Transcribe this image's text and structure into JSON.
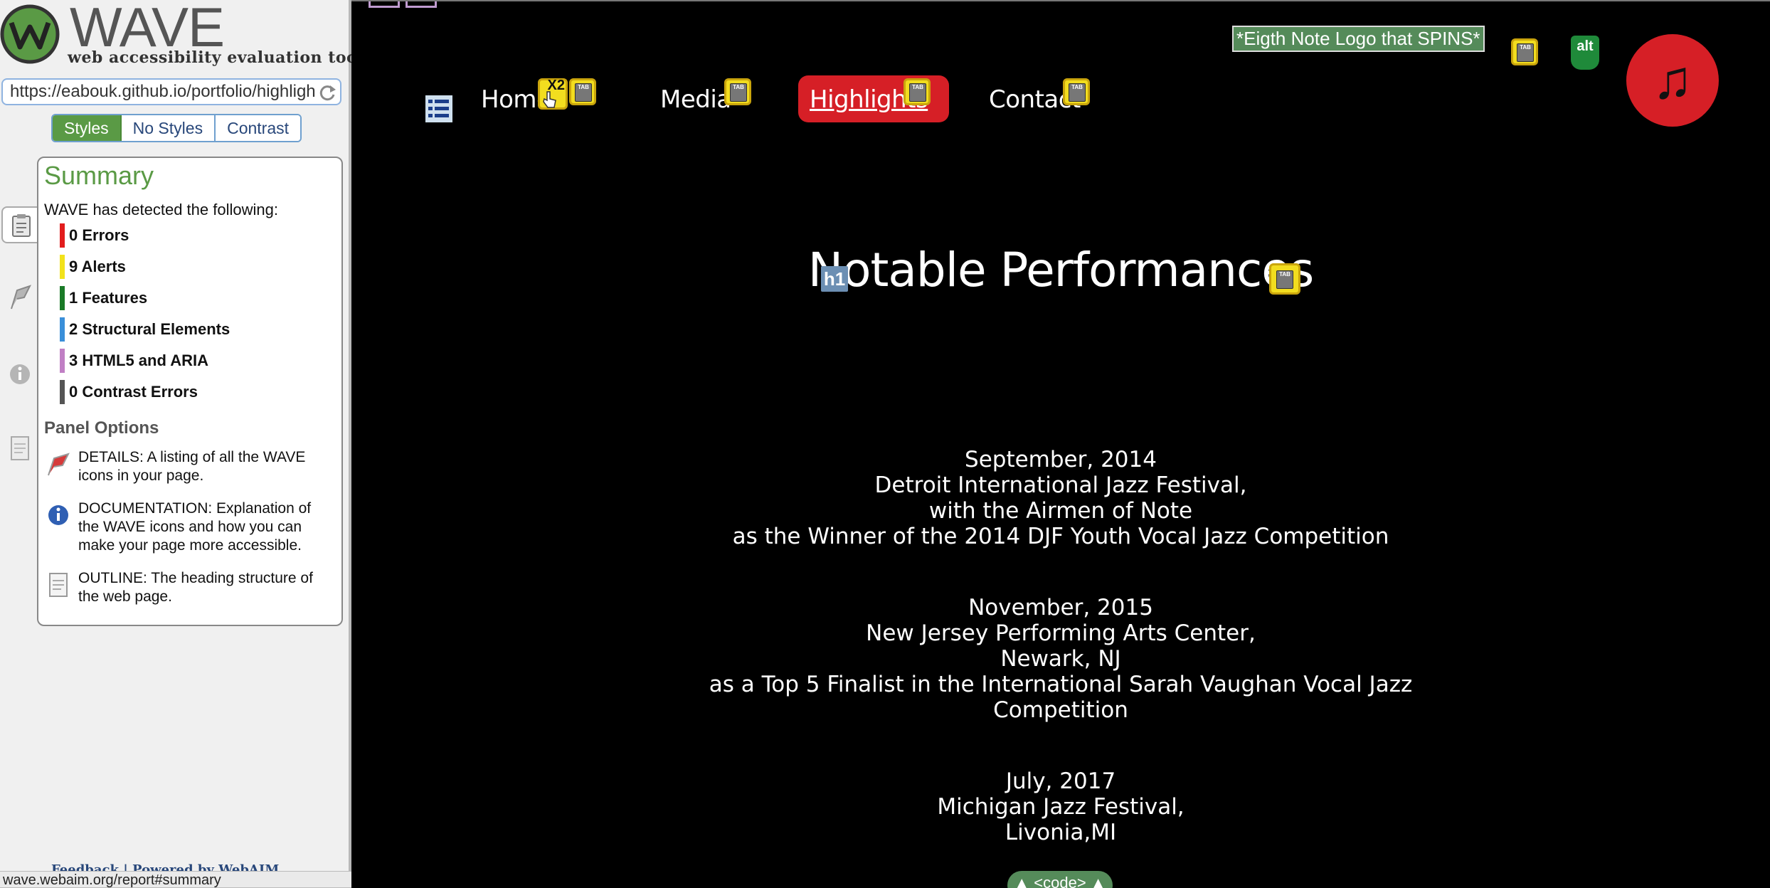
{
  "wave": {
    "title": "WAVE",
    "subtitle": "web accessibility evaluation tool",
    "url": "https://eabouk.github.io/portfolio/highligh",
    "view_tabs": [
      {
        "label": "Styles",
        "active": true
      },
      {
        "label": "No Styles",
        "active": false
      },
      {
        "label": "Contrast",
        "active": false
      }
    ],
    "summary": {
      "title": "Summary",
      "intro": "WAVE has detected the following:",
      "stats": [
        {
          "label": "0 Errors",
          "color": "#e21d1d"
        },
        {
          "label": "9 Alerts",
          "color": "#f2e21b"
        },
        {
          "label": "1 Features",
          "color": "#1a7a27"
        },
        {
          "label": "2 Structural Elements",
          "color": "#3a8fd9"
        },
        {
          "label": "3 HTML5 and ARIA",
          "color": "#c07fc4"
        },
        {
          "label": "0 Contrast Errors",
          "color": "#555555"
        }
      ],
      "panel_options_title": "Panel Options",
      "options": [
        {
          "icon": "flag-icon",
          "text": "DETAILS: A listing of all the WAVE icons in your page."
        },
        {
          "icon": "info-icon",
          "text": "DOCUMENTATION: Explanation of the WAVE icons and how you can make your page more accessible."
        },
        {
          "icon": "outline-doc-icon",
          "text": "OUTLINE: The heading structure of the web page."
        }
      ]
    },
    "footer_links": "Feedback | Powered by WebAIM",
    "status_url": "wave.webaim.org/report#summary"
  },
  "page": {
    "nav": [
      {
        "label": "Home"
      },
      {
        "label": "Media"
      },
      {
        "label": "Highlights",
        "active": true
      },
      {
        "label": "Contact"
      }
    ],
    "logo_alt": "*Eigth Note Logo that SPINS*",
    "alt_badge": "alt",
    "x2_badge": "X2",
    "tab_badge": "TAB",
    "music_glyph": "♫",
    "h1_badge": "h1",
    "title": "Notable Performances",
    "performances": [
      {
        "lines": [
          "September, 2014",
          "Detroit International Jazz Festival,",
          "with the Airmen of Note",
          "as the Winner of the 2014 DJF Youth Vocal Jazz Competition"
        ]
      },
      {
        "lines": [
          "November, 2015",
          "New Jersey Performing Arts Center,",
          "Newark, NJ",
          "as a Top 5 Finalist in the International Sarah Vaughan Vocal Jazz",
          "Competition"
        ]
      },
      {
        "lines": [
          "July, 2017",
          "Michigan Jazz Festival,",
          "Livonia,MI"
        ]
      }
    ],
    "code_toggle": "▲ <code> ▲",
    "colors": {
      "accent_red": "#d61f26",
      "wave_green": "#5a9a45",
      "badge_yellow": "#f2dd1f"
    }
  }
}
